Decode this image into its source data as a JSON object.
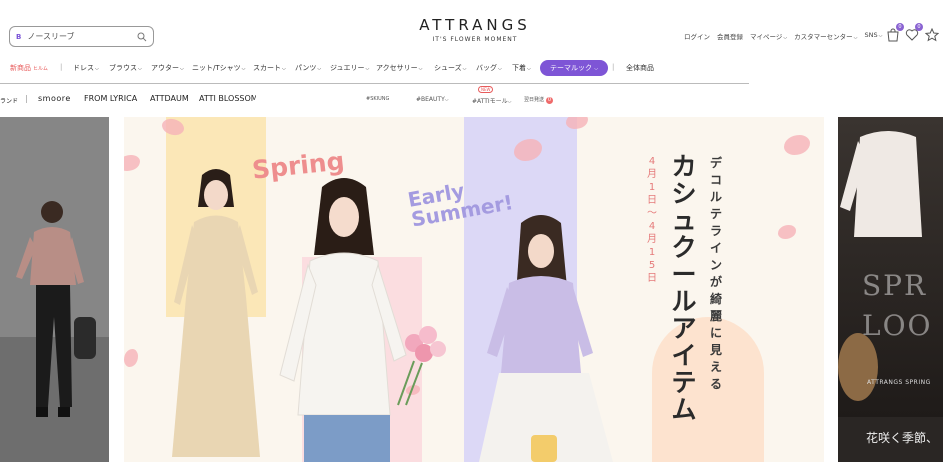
{
  "header": {
    "search": {
      "badge": "B",
      "placeholder": "ノースリーブ"
    },
    "logo": {
      "title": "ATTRANGS",
      "tagline": "IT'S FLOWER MOMENT"
    },
    "util": [
      "ログイン",
      "会員登録",
      "マイページ",
      "カスタマーセンター",
      "SNS"
    ],
    "cart_count": "0",
    "wish_count": "0"
  },
  "categories": {
    "new": "新商品",
    "new_sub": "ヒルム",
    "items": [
      "ドレス",
      "ブラウス",
      "アウター",
      "ニット/Tシャツ",
      "スカート",
      "パンツ",
      "ジュエリー",
      "アクセサリー",
      "シューズ",
      "バッグ",
      "下着"
    ],
    "theme_button": "テーマルック",
    "all": "全体商品"
  },
  "brands": {
    "left_cut": "ランド",
    "items": [
      "smoore",
      "FROM LYRICA",
      "ATTDAUM",
      "ATTI BLOSSOM"
    ],
    "tags": [
      "#SKIUNG",
      "#BEAUTY",
      "#ATTIモール",
      "翌日発送"
    ],
    "hot_label": "NEW",
    "next_day_badge": "0"
  },
  "banner": {
    "spring_word": "Spring",
    "early_word_1": "Early",
    "early_word_2": "Summer!",
    "date_text": "4月1日〜4月15日",
    "title": "カシュクールアイテム",
    "subtitle": "デコルテラインが綺麗に見える",
    "right_panel": {
      "h1": "SPR",
      "h2": "LOO",
      "sub": "ATTRANGS SPRING",
      "jp": "花咲く季節、"
    },
    "colors": {
      "accent": "#7e55d6",
      "spring": "#ee8e8e",
      "early": "#a49be0",
      "date": "#e57a7a"
    }
  }
}
